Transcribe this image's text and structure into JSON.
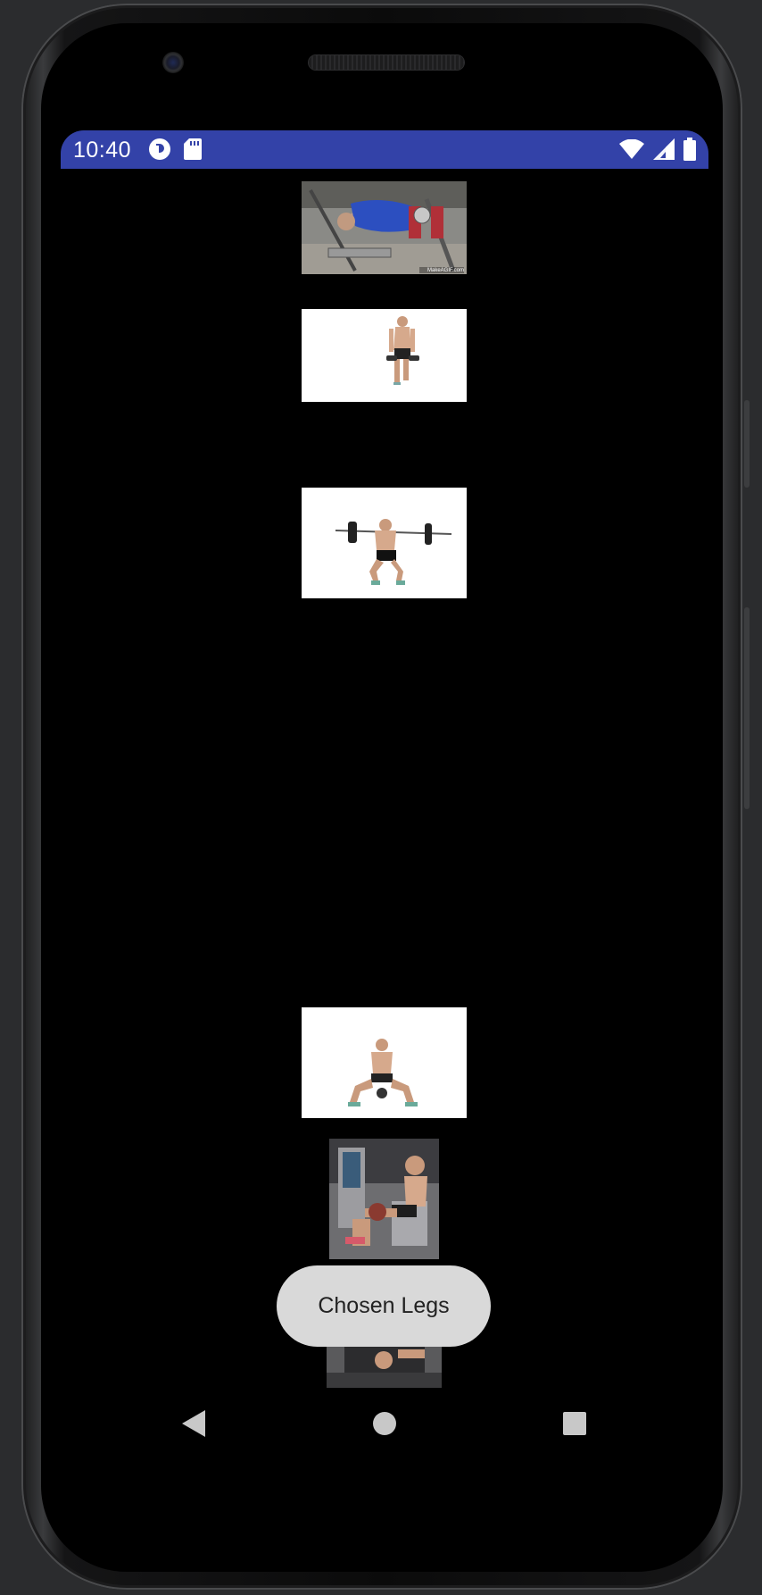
{
  "status_bar": {
    "time": "10:40",
    "left_icons": [
      "circle-g-icon",
      "sd-card-icon"
    ],
    "right_icons": [
      "wifi-icon",
      "signal-icon",
      "battery-icon"
    ],
    "color": "#3342a8"
  },
  "exercise_list": {
    "images": [
      {
        "name": "leg-curl-gif",
        "watermark": "MakeAGIF.com"
      },
      {
        "name": "dumbbell-lunge"
      },
      {
        "name": "barbell-squat"
      },
      {
        "name": "kettlebell-sumo-squat"
      },
      {
        "name": "leg-extension-machine"
      },
      {
        "name": "leg-press-machine"
      }
    ]
  },
  "toast": {
    "text": "Chosen Legs"
  },
  "navigation": {
    "buttons": [
      "back-icon",
      "home-icon",
      "recents-icon"
    ]
  }
}
